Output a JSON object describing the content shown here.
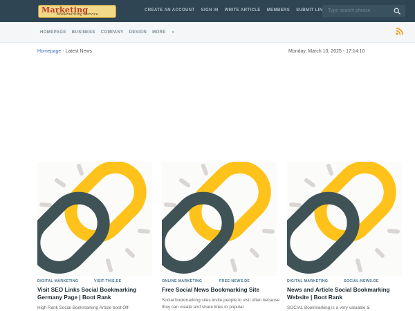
{
  "header": {
    "logo_text": "Marketing",
    "logo_sub": "Bookmarking Service",
    "nav": [
      "CREATE AN ACCOUNT",
      "SIGN IN",
      "WRITE ARTICLE",
      "MEMBERS",
      "SUBMIT LINK"
    ],
    "search_placeholder": "Type search phrase"
  },
  "subnav": {
    "items": [
      "HOMEPAGE",
      "BUSINESS",
      "COMPANY",
      "DESIGN",
      "MORE"
    ]
  },
  "breadcrumb": {
    "home": "Homepage",
    "separator": "-",
    "current": "Latest News"
  },
  "date_text": "Monday, March 10, 2025 - 17:14:10",
  "cards": [
    {
      "category": "DIGITAL MARKETING",
      "source": "VISIT-THIS.DE",
      "title": "Visit SEO Links Social Bookmarking Germany Page | Boot Rank",
      "excerpt": "High Rank Social Bookmarking Article boot Off-"
    },
    {
      "category": "ONLINE MARKETING",
      "source": "FREE-NEWS.DE",
      "title": "Free Social News Bookmarking Site",
      "excerpt": "Social bookmarking sites invite people to visit often because they can create and share links to popular"
    },
    {
      "category": "DIGITAL MARKETING",
      "source": "SOCIAL-NEWS.DE",
      "title": "News and Article Social Bookmarking Website | Boot Rank",
      "excerpt": "SOCIAL Bookmarking is a very valuable &"
    }
  ],
  "colors": {
    "topbar": "#2f4553",
    "link_yellow": "#ffc21a",
    "link_orange": "#f5a612",
    "link_dark": "#3f5357",
    "category": "#46728f",
    "rss": "#f39a1c"
  },
  "icons": {
    "search": "search-icon",
    "rss": "rss-icon",
    "more": "chevron-down-icon"
  }
}
